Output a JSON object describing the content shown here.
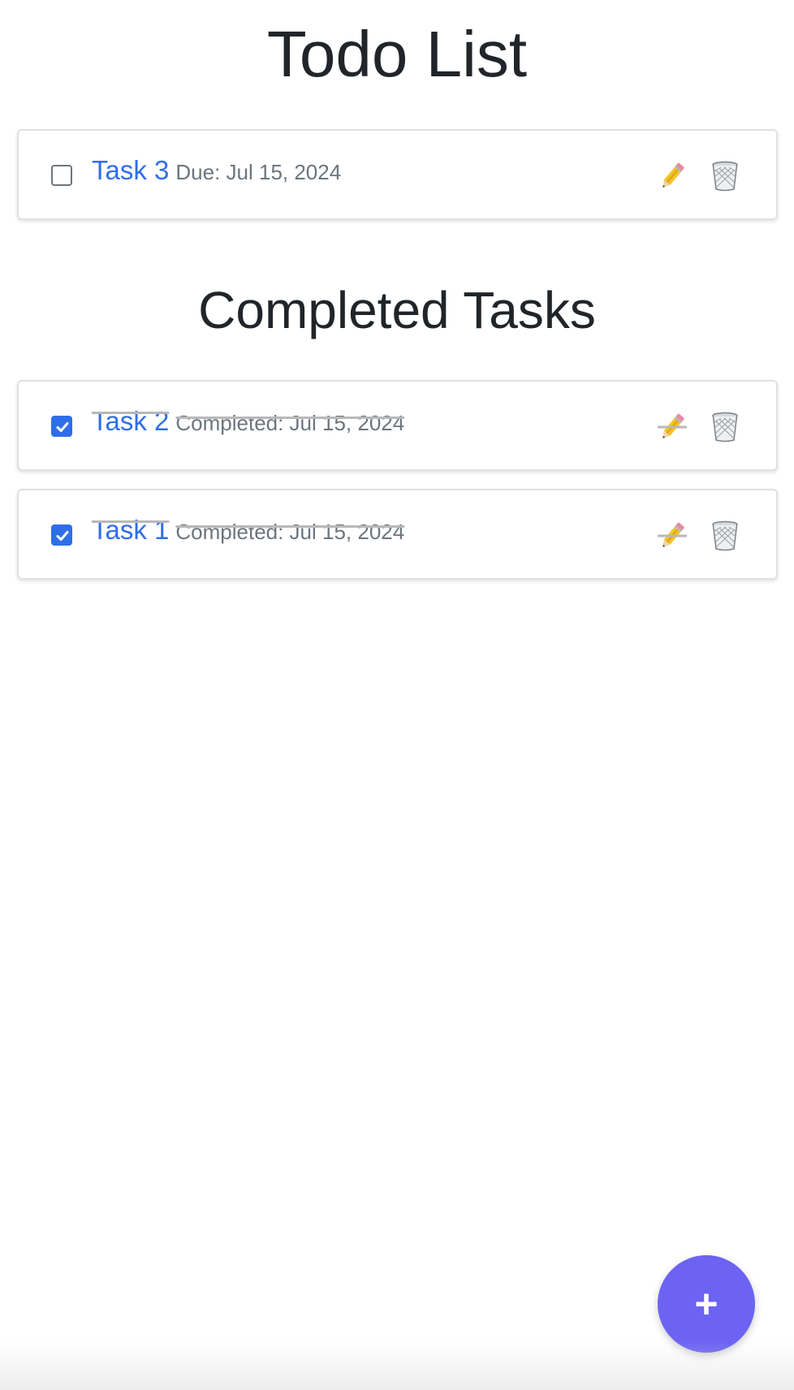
{
  "header": {
    "title": "Todo List"
  },
  "active_tasks": [
    {
      "name": "Task 3",
      "date_text": "Due: Jul 15, 2024",
      "checked": false
    }
  ],
  "completed_section": {
    "title": "Completed Tasks"
  },
  "completed_tasks": [
    {
      "name": "Task 2",
      "date_text": "Completed: Jul 15, 2024",
      "checked": true
    },
    {
      "name": "Task 1",
      "date_text": "Completed: Jul 15, 2024",
      "checked": true
    }
  ],
  "icons": {
    "edit": "pencil-icon",
    "delete": "trash-icon",
    "add": "plus-icon"
  },
  "fab": {
    "label": "+"
  },
  "colors": {
    "accent": "#2f6ee8",
    "fab": "#6c63f2",
    "muted_text": "#6c757d"
  }
}
